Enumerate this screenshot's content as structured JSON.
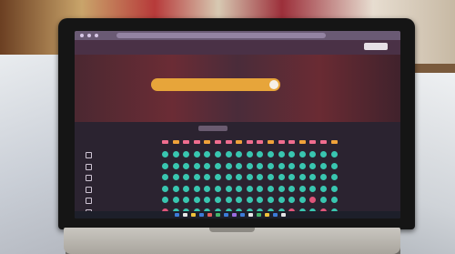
{
  "colors": {
    "screen_bg": "#3a2a34",
    "search_orange": "#e7a53a",
    "dot_teal": "#39c6b0",
    "dot_pink": "#e0557a",
    "dot_orange": "#e59a3b",
    "head_pink": "#f06d8f",
    "head_orange": "#f0a23a"
  },
  "icons": [
    "search-icon",
    "checkbox-icon"
  ],
  "screen": {
    "app_title": "",
    "header_button": "",
    "search_placeholder": "",
    "hero_caption": "",
    "section_tab": ""
  },
  "grid": {
    "rows": [
      {
        "label": "",
        "count": ""
      },
      {
        "label": "",
        "count": ""
      },
      {
        "label": "",
        "count": ""
      },
      {
        "label": "",
        "count": ""
      },
      {
        "label": "",
        "count": ""
      },
      {
        "label": "",
        "count": ""
      }
    ],
    "head_pattern": [
      "pink",
      "orange",
      "pink",
      "pink",
      "orange",
      "pink",
      "pink",
      "orange",
      "pink",
      "pink",
      "orange",
      "pink",
      "pink",
      "orange",
      "pink",
      "pink",
      "orange"
    ],
    "dot_pattern": [
      [
        "teal",
        "teal",
        "teal",
        "teal",
        "teal",
        "teal",
        "teal",
        "teal",
        "teal",
        "teal",
        "teal",
        "teal",
        "teal",
        "teal",
        "teal",
        "teal",
        "teal"
      ],
      [
        "teal",
        "teal",
        "teal",
        "teal",
        "teal",
        "teal",
        "teal",
        "teal",
        "teal",
        "teal",
        "teal",
        "teal",
        "teal",
        "teal",
        "teal",
        "teal",
        "teal"
      ],
      [
        "teal",
        "teal",
        "teal",
        "teal",
        "teal",
        "teal",
        "teal",
        "teal",
        "teal",
        "teal",
        "teal",
        "teal",
        "teal",
        "teal",
        "teal",
        "teal",
        "teal"
      ],
      [
        "teal",
        "teal",
        "teal",
        "teal",
        "teal",
        "teal",
        "teal",
        "teal",
        "teal",
        "teal",
        "teal",
        "teal",
        "teal",
        "teal",
        "teal",
        "teal",
        "teal"
      ],
      [
        "teal",
        "teal",
        "teal",
        "teal",
        "teal",
        "teal",
        "teal",
        "teal",
        "teal",
        "teal",
        "teal",
        "teal",
        "teal",
        "teal",
        "pink",
        "teal",
        "teal"
      ],
      [
        "pink",
        "teal",
        "teal",
        "teal",
        "teal",
        "teal",
        "teal",
        "teal",
        "teal",
        "teal",
        "teal",
        "teal",
        "pink",
        "teal",
        "teal",
        "pink",
        "teal"
      ]
    ]
  }
}
